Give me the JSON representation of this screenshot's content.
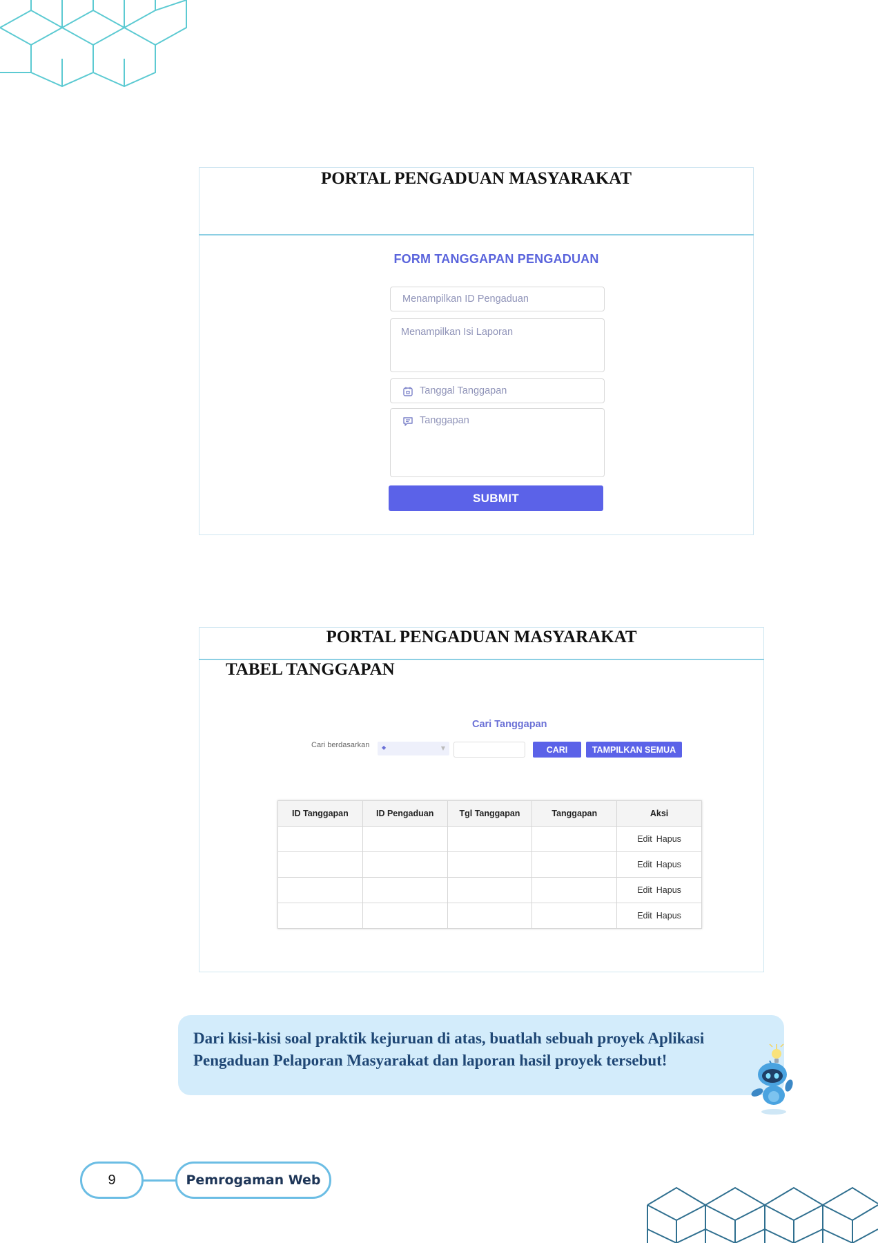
{
  "form_section": {
    "portal_title": "PORTAL PENGADUAN MASYARAKAT",
    "form_heading": "FORM TANGGAPAN PENGADUAN",
    "id_placeholder": "Menampilkan ID Pengaduan",
    "isi_placeholder": "Menampilkan Isi Laporan",
    "tanggal_placeholder": "Tanggal Tanggapan",
    "tanggapan_placeholder": "Tanggapan",
    "submit_label": "SUBMIT"
  },
  "table_section": {
    "portal_title": "PORTAL PENGADUAN MASYARAKAT",
    "table_heading": "TABEL TANGGAPAN",
    "search_heading": "Cari Tanggapan",
    "search_label": "Cari berdasarkan",
    "search_select_value": "",
    "cari_label": "CARI",
    "tampilkan_label": "TAMPILKAN SEMUA",
    "columns": [
      "ID Tanggapan",
      "ID Pengaduan",
      "Tgl Tanggapan",
      "Tanggapan",
      "Aksi"
    ],
    "rows": [
      {
        "edit": "Edit",
        "hapus": "Hapus"
      },
      {
        "edit": "Edit",
        "hapus": "Hapus"
      },
      {
        "edit": "Edit",
        "hapus": "Hapus"
      },
      {
        "edit": "Edit",
        "hapus": "Hapus"
      }
    ]
  },
  "callout": {
    "line1": "Dari kisi-kisi soal praktik kejuruan di atas, buatlah sebuah proyek Aplikasi",
    "line2": "Pengaduan Pelaporan Masyarakat dan laporan hasil proyek tersebut!"
  },
  "footer": {
    "page_number": "9",
    "book_title": "Pemrogaman Web"
  },
  "colors": {
    "accent": "#5b62e8",
    "border_blue": "#6bbde4",
    "callout_bg": "#d3ecfb",
    "callout_text": "#1f4775"
  }
}
